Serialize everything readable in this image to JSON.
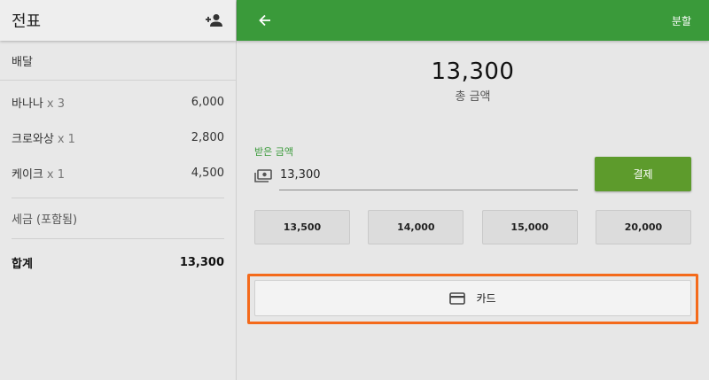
{
  "receipt": {
    "title": "전표",
    "order_type": "배달",
    "items": [
      {
        "name": "바나나",
        "qty": "x 3",
        "price": "6,000"
      },
      {
        "name": "크로와상",
        "qty": "x 1",
        "price": "2,800"
      },
      {
        "name": "케이크",
        "qty": "x 1",
        "price": "4,500"
      }
    ],
    "tax_label": "세금 (포함됨)",
    "total_label": "합계",
    "total_value": "13,300"
  },
  "payment": {
    "split_label": "분할",
    "amount": "13,300",
    "amount_label": "총 금액",
    "received_label": "받은 금액",
    "received_value": "13,300",
    "pay_label": "결제",
    "quick_amounts": [
      "13,500",
      "14,000",
      "15,000",
      "20,000"
    ],
    "card_label": "카드"
  },
  "colors": {
    "topbar": "#3a9a3a",
    "pay_button": "#5d9b2c",
    "highlight": "#f46a1b"
  }
}
